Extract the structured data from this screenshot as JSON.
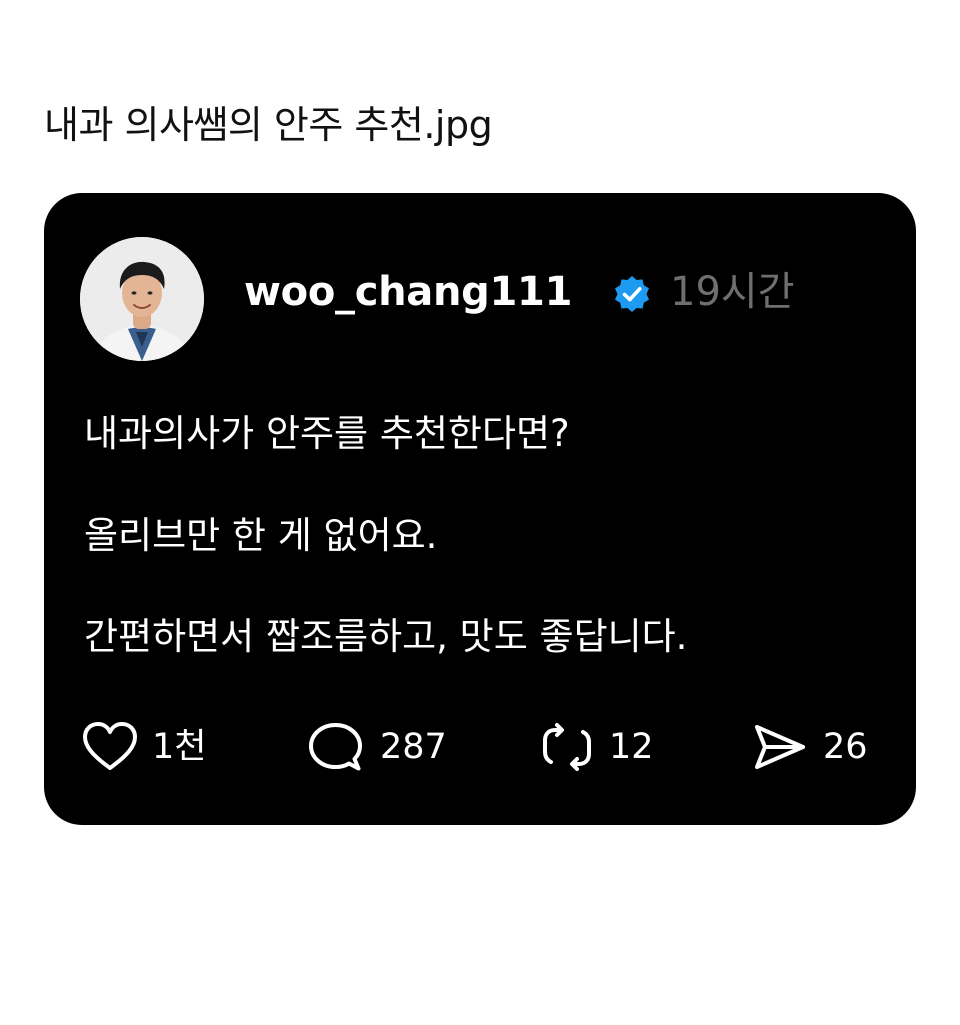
{
  "page": {
    "title": "내과 의사쌤의 안주 추천.jpg"
  },
  "post": {
    "username": "woo_chang111",
    "verified": true,
    "time": "19시간",
    "lines": [
      "내과의사가 안주를 추천한다면?",
      "올리브만 한 게 없어요.",
      "간편하면서 짭조름하고, 맛도 좋답니다."
    ],
    "actions": {
      "likes": "1천",
      "comments": "287",
      "reposts": "12",
      "shares": "26"
    },
    "icons": {
      "verified": "verified-badge-icon",
      "like": "heart-icon",
      "comment": "speech-bubble-icon",
      "repost": "repost-arrows-icon",
      "share": "send-arrow-icon"
    }
  },
  "colors": {
    "card_background": "#000000",
    "verified_badge": "#1d9bf0",
    "time_text": "#6f6f6f"
  }
}
